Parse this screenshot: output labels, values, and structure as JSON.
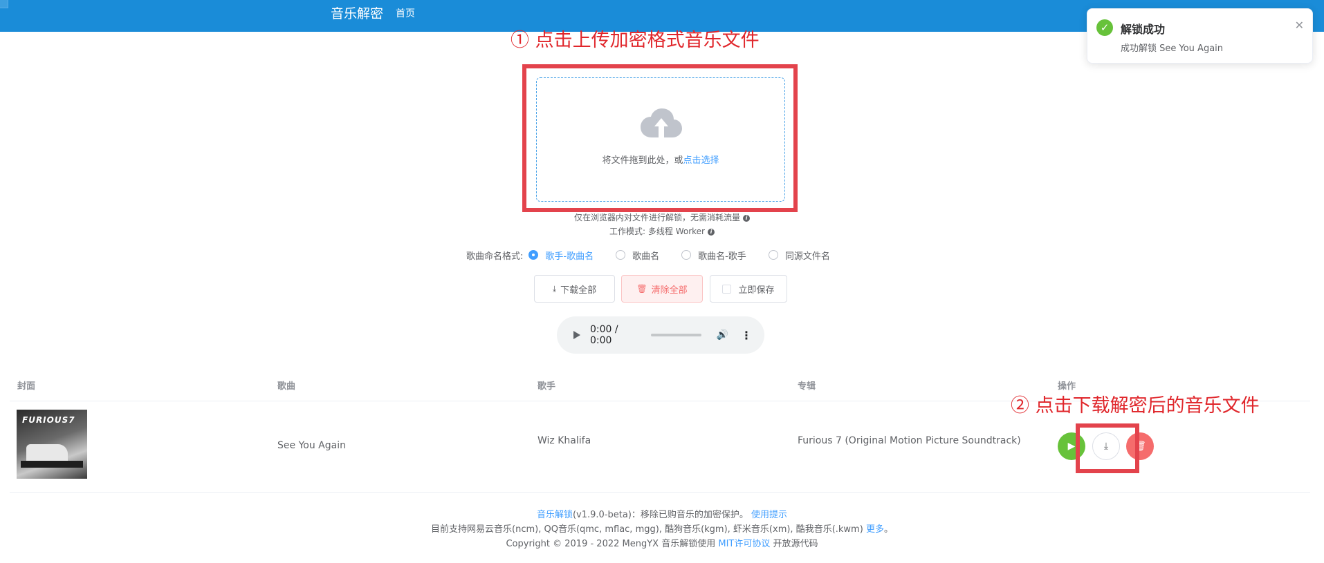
{
  "header": {
    "brand": "音乐解密",
    "nav_home": "首页"
  },
  "annotations": {
    "step1": "① 点击上传加密格式音乐文件",
    "step2": "② 点击下载解密后的音乐文件",
    "color": "#e3434c"
  },
  "upload": {
    "text": "将文件拖到此处，或",
    "link": "点击选择",
    "icon": "cloud-upload-icon"
  },
  "tips": {
    "line1": "仅在浏览器内对文件进行解锁，无需消耗流量",
    "line2": "工作模式: 多线程 Worker"
  },
  "naming": {
    "label": "歌曲命名格式:",
    "options": [
      "歌手-歌曲名",
      "歌曲名",
      "歌曲名-歌手",
      "同源文件名"
    ],
    "selected": "歌手-歌曲名"
  },
  "actions": {
    "download_all": "下载全部",
    "clear_all": "清除全部",
    "save_now": "立即保存"
  },
  "player": {
    "time": "0:00 / 0:00"
  },
  "table": {
    "columns": [
      "封面",
      "歌曲",
      "歌手",
      "专辑",
      "操作"
    ],
    "rows": [
      {
        "cover_text": "FURIOUS7",
        "song": "See You Again",
        "artist": "Wiz Khalifa",
        "album": "Furious 7 (Original Motion Picture Soundtrack)"
      }
    ]
  },
  "footer": {
    "line1_link": "音乐解锁",
    "line1_text": "(v1.9.0-beta)：移除已购音乐的加密保护。",
    "line1_link2": "使用提示",
    "line2_text": "目前支持网易云音乐(ncm), QQ音乐(qmc, mflac, mgg), 酷狗音乐(kgm), 虾米音乐(xm), 酷我音乐(.kwm)",
    "line2_link": "更多",
    "line2_end": "。",
    "line3_text": "Copyright © 2019 - 2022 MengYX 音乐解锁使用",
    "line3_link": "MIT许可协议",
    "line3_end": "开放源代码"
  },
  "toast": {
    "title": "解锁成功",
    "message": "成功解锁 See You Again"
  },
  "colors": {
    "header_bg": "#1a8cd8",
    "primary": "#409eff",
    "success": "#67c23a",
    "danger": "#f56c6c"
  }
}
